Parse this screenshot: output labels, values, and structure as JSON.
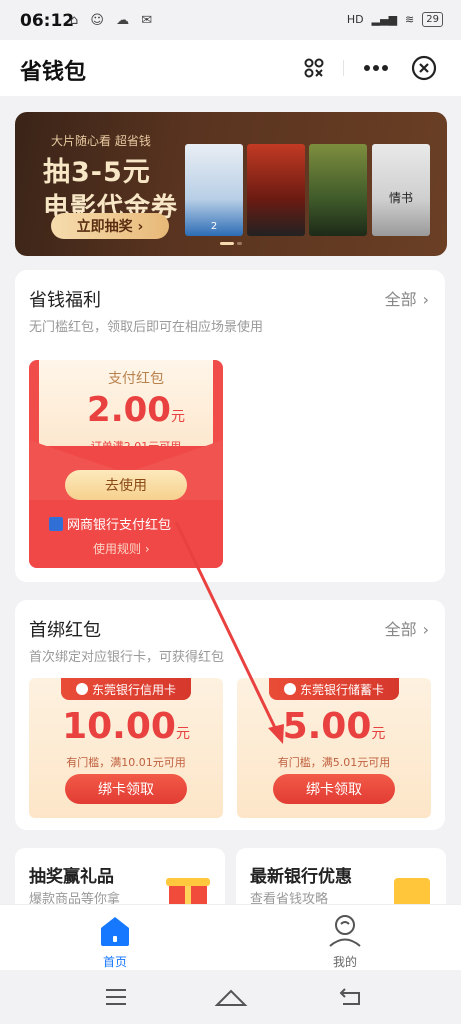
{
  "status_bar": {
    "time": "06:12",
    "battery": "29"
  },
  "header": {
    "title": "省钱包"
  },
  "banner": {
    "subtitle": "大片随心看 超省钱",
    "headline1": "抽3-5元",
    "headline2": "电影代金券",
    "cta": "立即抽奖 ›",
    "posters": [
      "2",
      "",
      "",
      "情书"
    ]
  },
  "welfare": {
    "title": "省钱福利",
    "all": "全部",
    "desc": "无门槛红包，领取后即可在相应场景使用",
    "packet": {
      "label": "支付红包",
      "amount": "2.00",
      "unit": "元",
      "condition": "订单满2.01元可用",
      "button": "去使用",
      "bank": "网商银行支付红包",
      "rules": "使用规则 ›"
    }
  },
  "first_bind": {
    "title": "首绑红包",
    "all": "全部",
    "desc": "首次绑定对应银行卡，可获得红包",
    "cards": [
      {
        "bank": "东莞银行信用卡",
        "amount": "10.00",
        "unit": "元",
        "condition": "有门槛，满10.01元可用",
        "button": "绑卡领取"
      },
      {
        "bank": "东莞银行储蓄卡",
        "amount": "5.00",
        "unit": "元",
        "condition": "有门槛，满5.01元可用",
        "button": "绑卡领取"
      }
    ]
  },
  "mini_cards": [
    {
      "title": "抽奖赢礼品",
      "desc": "爆款商品等你拿"
    },
    {
      "title": "最新银行优惠",
      "desc": "查看省钱攻略"
    }
  ],
  "tabs": {
    "home": "首页",
    "me": "我的"
  },
  "colors": {
    "accent": "#1677ff",
    "red": "#e8413f",
    "annotation": "#e8413f"
  }
}
